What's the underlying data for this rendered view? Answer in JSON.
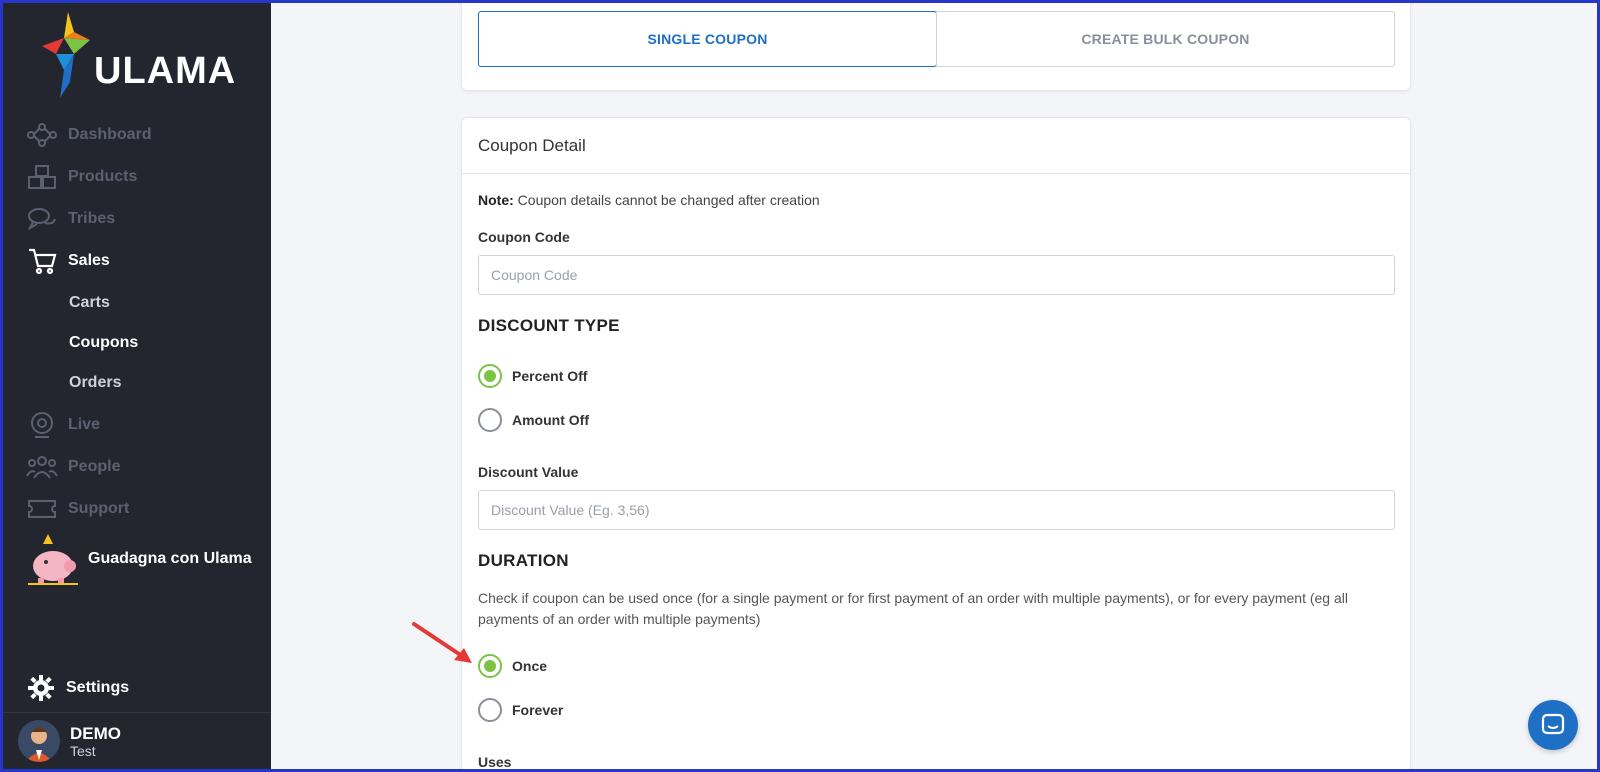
{
  "brand": {
    "name": "ULAMA"
  },
  "sidebar": {
    "items": [
      {
        "label": "Dashboard",
        "icon": "network-icon"
      },
      {
        "label": "Products",
        "icon": "boxes-icon"
      },
      {
        "label": "Tribes",
        "icon": "chat-bubbles-icon"
      },
      {
        "label": "Sales",
        "icon": "cart-icon"
      },
      {
        "label": "Live",
        "icon": "webcam-icon"
      },
      {
        "label": "People",
        "icon": "people-icon"
      },
      {
        "label": "Support",
        "icon": "ticket-icon"
      }
    ],
    "sales_sub": [
      "Carts",
      "Coupons",
      "Orders"
    ],
    "promo": {
      "label": "Guadagna con Ulama",
      "icon": "piggy-bank-icon"
    },
    "settings": "Settings",
    "user": {
      "name": "DEMO",
      "sub": "Test"
    }
  },
  "tabs": [
    "SINGLE COUPON",
    "CREATE BULK COUPON"
  ],
  "detail": {
    "title": "Coupon Detail",
    "note_label": "Note:",
    "note_text": "Coupon details cannot be changed after creation",
    "coupon_code_label": "Coupon Code",
    "coupon_code_placeholder": "Coupon Code",
    "discount_type_title": "DISCOUNT TYPE",
    "discount_options": [
      "Percent Off",
      "Amount Off"
    ],
    "discount_value_label": "Discount Value",
    "discount_value_placeholder": "Discount Value (Eg. 3,56)",
    "duration_title": "DURATION",
    "duration_desc": "Check if coupon can be used once (for a single payment or for first payment of an order with multiple payments), or for every payment (eg all payments of an order with multiple payments)",
    "duration_options": [
      "Once",
      "Forever"
    ],
    "uses_label": "Uses"
  },
  "colors": {
    "accent": "#1f6fc4",
    "radio_checked": "#7cc243",
    "sidebar": "#23252f",
    "arrow": "#e53935"
  }
}
